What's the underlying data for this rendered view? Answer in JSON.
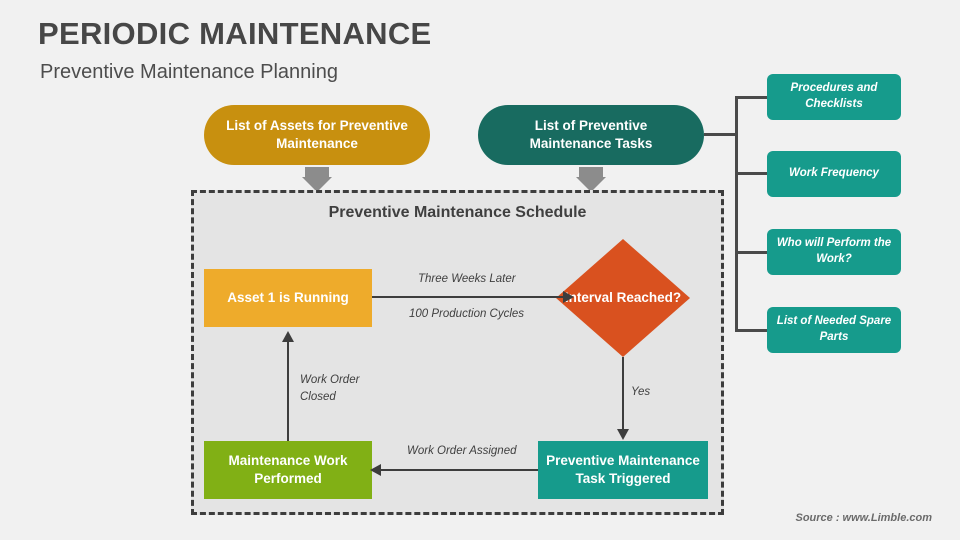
{
  "header": {
    "title": "PERIODIC MAINTENANCE",
    "subtitle": "Preventive Maintenance Planning"
  },
  "inputs": {
    "assets_pill": "List of Assets for Preventive Maintenance",
    "tasks_pill": "List of Preventive Maintenance Tasks"
  },
  "schedule": {
    "panel_title": "Preventive Maintenance Schedule",
    "nodes": {
      "asset_running": "Asset 1 is Running",
      "interval_decision": "Interval Reached?",
      "pm_task_triggered": "Preventive Maintenance Task Triggered",
      "maintenance_performed": "Maintenance Work Performed"
    },
    "edges": {
      "three_weeks_later": "Three Weeks Later",
      "production_cycles": "100 Production Cycles",
      "yes": "Yes",
      "work_order_assigned": "Work Order Assigned",
      "work_order_closed": "Work Order Closed"
    }
  },
  "task_details": [
    {
      "label": "Procedures and Checklists"
    },
    {
      "label": "Work Frequency"
    },
    {
      "label": "Who will Perform the Work?"
    },
    {
      "label": "List of Needed Spare Parts"
    }
  ],
  "footer": {
    "source": "Source : www.Limble.com"
  },
  "colors": {
    "background": "#f1f1f1",
    "panel": "#e4e4e4",
    "gold": "#c8900f",
    "dark_teal": "#186b60",
    "teal": "#169b8c",
    "amber": "#eeab2b",
    "orange_red": "#d9511f",
    "green": "#81b015",
    "line": "#3d3d3d",
    "gray_arrow": "#8c8c8c"
  }
}
